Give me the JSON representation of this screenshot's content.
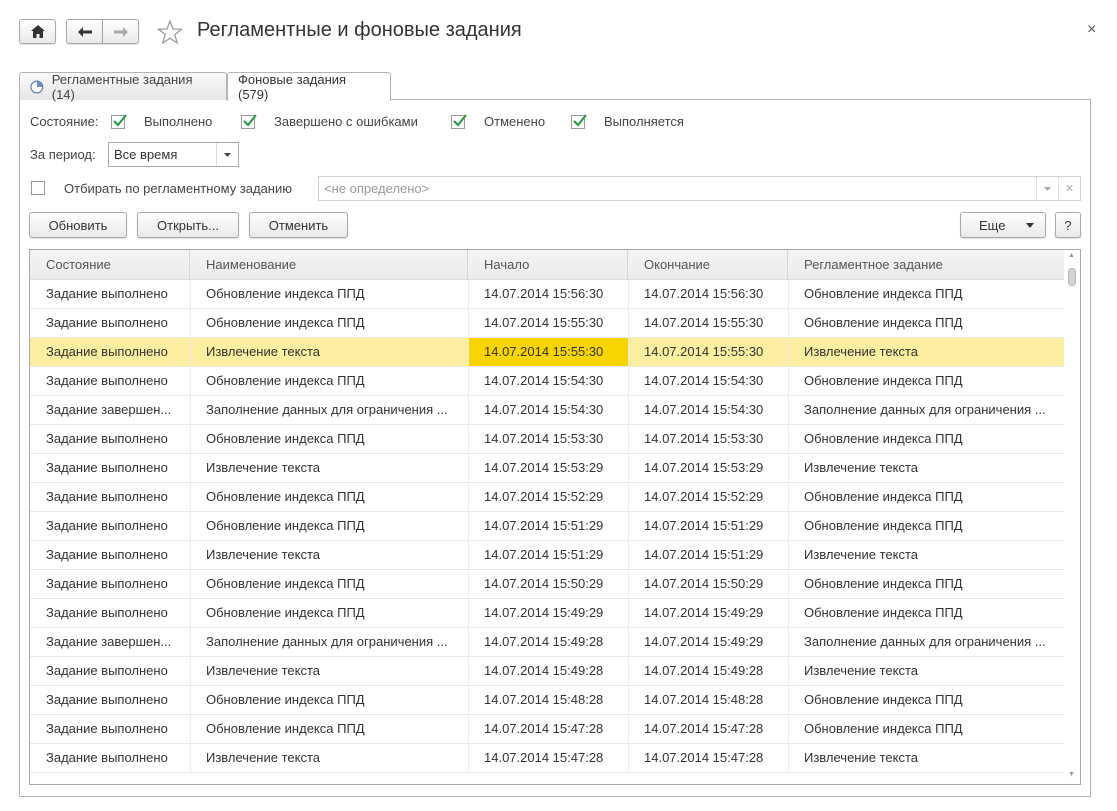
{
  "window": {
    "title": "Регламентные и фоновые задания",
    "close_glyph": "×"
  },
  "tabs": [
    {
      "label": "Регламентные задания (14)",
      "active": false
    },
    {
      "label": "Фоновые задания (579)",
      "active": true
    }
  ],
  "filters": {
    "state_label": "Состояние:",
    "states": [
      {
        "label": "Выполнено",
        "checked": true
      },
      {
        "label": "Завершено с ошибками",
        "checked": true
      },
      {
        "label": "Отменено",
        "checked": true
      },
      {
        "label": "Выполняется",
        "checked": true
      }
    ],
    "period_label": "За период:",
    "period_value": "Все время",
    "by_scheduled_label": "Отбирать по регламентному заданию",
    "by_scheduled_checked": false,
    "by_scheduled_placeholder": "<не определено>"
  },
  "toolbar": {
    "refresh_label": "Обновить",
    "open_label": "Открыть...",
    "cancel_label": "Отменить",
    "more_label": "Еще",
    "help_label": "?"
  },
  "table": {
    "columns": [
      "Состояние",
      "Наименование",
      "Начало",
      "Окончание",
      "Регламентное задание"
    ],
    "rows": [
      [
        "Задание выполнено",
        "Обновление индекса ППД",
        "14.07.2014 15:56:30",
        "14.07.2014 15:56:30",
        "Обновление индекса ППД"
      ],
      [
        "Задание выполнено",
        "Обновление индекса ППД",
        "14.07.2014 15:55:30",
        "14.07.2014 15:55:30",
        "Обновление индекса ППД"
      ],
      [
        "Задание выполнено",
        "Извлечение текста",
        "14.07.2014 15:55:30",
        "14.07.2014 15:55:30",
        "Извлечение текста"
      ],
      [
        "Задание выполнено",
        "Обновление индекса ППД",
        "14.07.2014 15:54:30",
        "14.07.2014 15:54:30",
        "Обновление индекса ППД"
      ],
      [
        "Задание завершен...",
        "Заполнение данных для ограничения ...",
        "14.07.2014 15:54:30",
        "14.07.2014 15:54:30",
        "Заполнение данных для ограничения ..."
      ],
      [
        "Задание выполнено",
        "Обновление индекса ППД",
        "14.07.2014 15:53:30",
        "14.07.2014 15:53:30",
        "Обновление индекса ППД"
      ],
      [
        "Задание выполнено",
        "Извлечение текста",
        "14.07.2014 15:53:29",
        "14.07.2014 15:53:29",
        "Извлечение текста"
      ],
      [
        "Задание выполнено",
        "Обновление индекса ППД",
        "14.07.2014 15:52:29",
        "14.07.2014 15:52:29",
        "Обновление индекса ППД"
      ],
      [
        "Задание выполнено",
        "Обновление индекса ППД",
        "14.07.2014 15:51:29",
        "14.07.2014 15:51:29",
        "Обновление индекса ППД"
      ],
      [
        "Задание выполнено",
        "Извлечение текста",
        "14.07.2014 15:51:29",
        "14.07.2014 15:51:29",
        "Извлечение текста"
      ],
      [
        "Задание выполнено",
        "Обновление индекса ППД",
        "14.07.2014 15:50:29",
        "14.07.2014 15:50:29",
        "Обновление индекса ППД"
      ],
      [
        "Задание выполнено",
        "Обновление индекса ППД",
        "14.07.2014 15:49:29",
        "14.07.2014 15:49:29",
        "Обновление индекса ППД"
      ],
      [
        "Задание завершен...",
        "Заполнение данных для ограничения ...",
        "14.07.2014 15:49:28",
        "14.07.2014 15:49:29",
        "Заполнение данных для ограничения ..."
      ],
      [
        "Задание выполнено",
        "Извлечение текста",
        "14.07.2014 15:49:28",
        "14.07.2014 15:49:28",
        "Извлечение текста"
      ],
      [
        "Задание выполнено",
        "Обновление индекса ППД",
        "14.07.2014 15:48:28",
        "14.07.2014 15:48:28",
        "Обновление индекса ППД"
      ],
      [
        "Задание выполнено",
        "Обновление индекса ППД",
        "14.07.2014 15:47:28",
        "14.07.2014 15:47:28",
        "Обновление индекса ППД"
      ],
      [
        "Задание выполнено",
        "Извлечение текста",
        "14.07.2014 15:47:28",
        "14.07.2014 15:47:28",
        "Извлечение текста"
      ]
    ],
    "selected_row": 2,
    "selected_col": 2
  },
  "colors": {
    "selected_row": "#fbeea0",
    "selected_cell": "#f8d400",
    "checkmark": "#1e9a3a"
  },
  "icons": [
    "home-icon",
    "back-arrow-icon",
    "forward-arrow-icon",
    "star-icon",
    "clock-icon",
    "check-icon",
    "dropdown-arrow-icon",
    "clear-icon"
  ]
}
